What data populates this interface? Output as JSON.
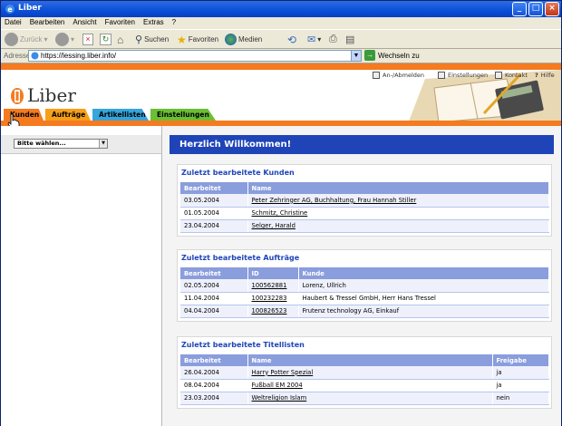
{
  "window": {
    "title": "Liber"
  },
  "menu": [
    "Datei",
    "Bearbeiten",
    "Ansicht",
    "Favoriten",
    "Extras",
    "?"
  ],
  "toolbar": {
    "back": "Zurück",
    "search": "Suchen",
    "favorites": "Favoriten",
    "media": "Medien"
  },
  "address": {
    "label": "Adresse",
    "url": "https://lessing.liber.info/",
    "go": "Wechseln zu"
  },
  "utility": {
    "login": "An-/Abmelden",
    "settings": "Einstellungen",
    "contact": "Kontakt",
    "help": "Hilfe"
  },
  "logo": {
    "text": "Liber"
  },
  "tabs": [
    {
      "label": "Kunden",
      "color": "#F47B20"
    },
    {
      "label": "Aufträge",
      "color": "#F6A019"
    },
    {
      "label": "Artikellisten",
      "color": "#36A5DC"
    },
    {
      "label": "Einstellungen",
      "color": "#6BBF34"
    }
  ],
  "sidebar": {
    "select": "Bitte wählen..."
  },
  "welcome": "Herzlich Willkommen!",
  "panels": {
    "kunden": {
      "title": "Zuletzt bearbeitete Kunden",
      "headers": [
        "Bearbeitet",
        "Name"
      ],
      "rows": [
        [
          "03.05.2004",
          "Peter Zehringer AG, Buchhaltung, Frau Hannah Stiller"
        ],
        [
          "01.05.2004",
          "Schmitz, Christine"
        ],
        [
          "23.04.2004",
          "Selger, Harald"
        ]
      ]
    },
    "auftraege": {
      "title": "Zuletzt bearbeitete Aufträge",
      "headers": [
        "Bearbeitet",
        "ID",
        "Kunde"
      ],
      "rows": [
        [
          "02.05.2004",
          "100562881",
          "Lorenz, Ullrich"
        ],
        [
          "11.04.2004",
          "100232283",
          "Haubert & Tressel GmbH, Herr Hans Tressel"
        ],
        [
          "04.04.2004",
          "100826523",
          "Frutenz technology AG, Einkauf"
        ]
      ]
    },
    "titel": {
      "title": "Zuletzt bearbeitete Titellisten",
      "headers": [
        "Bearbeitet",
        "Name",
        "Freigabe"
      ],
      "rows": [
        [
          "26.04.2004",
          "Harry Potter Spezial",
          "ja"
        ],
        [
          "08.04.2004",
          "Fußball EM 2004",
          "ja"
        ],
        [
          "23.03.2004",
          "Weltreligion Islam",
          "nein"
        ]
      ]
    }
  }
}
